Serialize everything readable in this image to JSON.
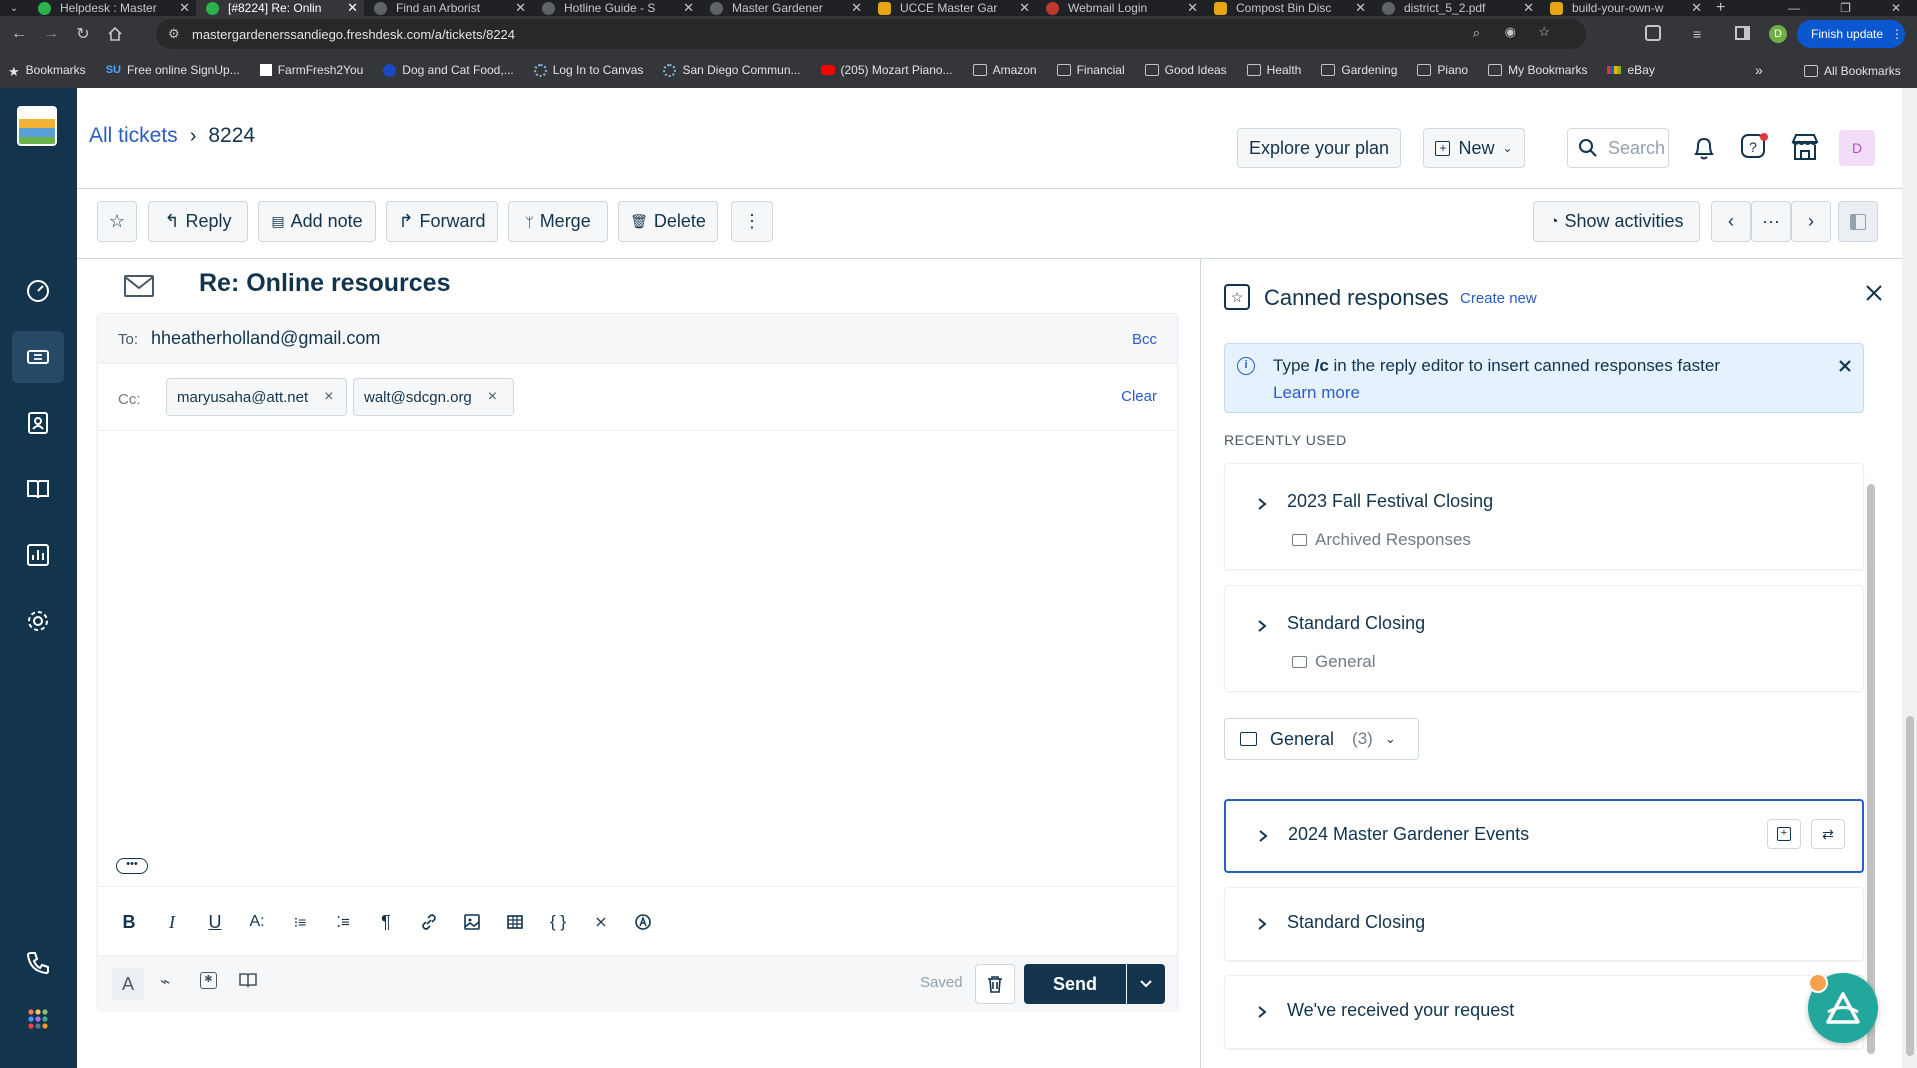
{
  "browser": {
    "tabs": [
      {
        "title": "Helpdesk : Master",
        "favicon_color": "#2bb24c",
        "active": false
      },
      {
        "title": "[#8224] Re: Onlin",
        "favicon_color": "#2bb24c",
        "active": true
      },
      {
        "title": "Find an Arborist",
        "favicon_color": "#5f6368",
        "active": false
      },
      {
        "title": "Hotline Guide - S",
        "favicon_color": "#5f6368",
        "active": false
      },
      {
        "title": "Master Gardener",
        "favicon_color": "#5f6368",
        "active": false
      },
      {
        "title": "UCCE Master Gar",
        "favicon_color": "#e8a317",
        "active": false
      },
      {
        "title": "Webmail Login",
        "favicon_color": "#c0392b",
        "active": false
      },
      {
        "title": "Compost Bin Disc",
        "favicon_color": "#e8a317",
        "active": false
      },
      {
        "title": "district_5_2.pdf",
        "favicon_color": "#5f6368",
        "active": false
      },
      {
        "title": "build-your-own-w",
        "favicon_color": "#e8a317",
        "active": false
      }
    ],
    "url": "mastergardenerssandiego.freshdesk.com/a/tickets/8224",
    "finish_update_label": "Finish update",
    "profile_initial": "D",
    "bookmarks": [
      {
        "label": "Bookmarks",
        "icon": "star-icon"
      },
      {
        "label": "Free online SignUp...",
        "icon": "su-icon"
      },
      {
        "label": "FarmFresh2You",
        "icon": "farmfresh-icon"
      },
      {
        "label": "Dog and Cat Food,...",
        "icon": "chewy-icon"
      },
      {
        "label": "Log In to Canvas",
        "icon": "canvas-icon"
      },
      {
        "label": "San Diego Commun...",
        "icon": "canvas-icon"
      },
      {
        "label": "(205) Mozart Piano...",
        "icon": "youtube-icon"
      },
      {
        "label": "Amazon",
        "icon": "folder-icon"
      },
      {
        "label": "Financial",
        "icon": "folder-icon"
      },
      {
        "label": "Good Ideas",
        "icon": "folder-icon"
      },
      {
        "label": "Health",
        "icon": "folder-icon"
      },
      {
        "label": "Gardening",
        "icon": "folder-icon"
      },
      {
        "label": "Piano",
        "icon": "folder-icon"
      },
      {
        "label": "My Bookmarks",
        "icon": "folder-icon"
      },
      {
        "label": "eBay",
        "icon": "ebay-icon"
      }
    ],
    "all_bookmarks_label": "All Bookmarks"
  },
  "header": {
    "breadcrumb_root": "All tickets",
    "ticket_id": "8224",
    "explore_label": "Explore your plan",
    "new_label": "New",
    "search_placeholder": "Search",
    "avatar_initial": "D"
  },
  "toolbar": {
    "reply": "Reply",
    "add_note": "Add note",
    "forward": "Forward",
    "merge": "Merge",
    "delete": "Delete",
    "show_activities": "Show activities"
  },
  "ticket": {
    "subject": "Re: Online resources",
    "to_label": "To:",
    "to_value": "hheatherholland@gmail.com",
    "bcc_label": "Bcc",
    "cc_label": "Cc:",
    "cc": [
      "maryusaha@att.net",
      "walt@sdcgn.org"
    ],
    "clear_label": "Clear",
    "saved_label": "Saved",
    "send_label": "Send"
  },
  "canned": {
    "title": "Canned responses",
    "create_new": "Create new",
    "tip_pre": "Type ",
    "tip_cmd": "/c",
    "tip_post": " in the reply editor to insert canned responses faster",
    "learn_more": "Learn more",
    "recently_used_label": "RECENTLY USED",
    "recent": [
      {
        "title": "2023 Fall Festival Closing",
        "folder": "Archived Responses"
      },
      {
        "title": "Standard Closing",
        "folder": "General"
      }
    ],
    "folder_name": "General",
    "folder_count": "(3)",
    "items": [
      {
        "title": "2024 Master Gardener Events"
      },
      {
        "title": "Standard Closing"
      },
      {
        "title": "We've received your request"
      }
    ]
  },
  "colors": {
    "primary": "#2c5cc5",
    "sidebar": "#12344d",
    "send_button": "#12344d",
    "info_banner": "#e5f2fd",
    "selected_border": "#2c5cc5"
  }
}
